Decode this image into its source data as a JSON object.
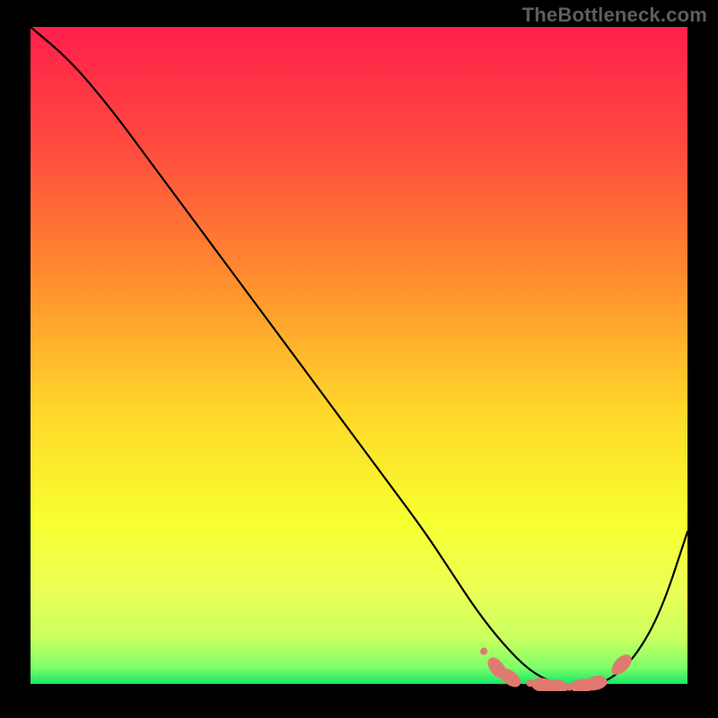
{
  "watermark": "TheBottleneck.com",
  "colors": {
    "background": "#000000",
    "gradient_stops": [
      {
        "offset": 0.0,
        "color": "#ff1f4b"
      },
      {
        "offset": 0.18,
        "color": "#ff4a3f"
      },
      {
        "offset": 0.38,
        "color": "#ff8c2e"
      },
      {
        "offset": 0.58,
        "color": "#ffd62a"
      },
      {
        "offset": 0.75,
        "color": "#f7ff2f"
      },
      {
        "offset": 0.86,
        "color": "#eaff56"
      },
      {
        "offset": 0.93,
        "color": "#c9ff60"
      },
      {
        "offset": 0.975,
        "color": "#7dff69"
      },
      {
        "offset": 1.0,
        "color": "#17e766"
      }
    ],
    "curve": "#000000",
    "beads": "#e07a70"
  },
  "chart_data": {
    "type": "line",
    "title": "",
    "xlabel": "",
    "ylabel": "",
    "xlim": [
      0,
      100
    ],
    "ylim": [
      0,
      100
    ],
    "grid": false,
    "legend": false,
    "series": [
      {
        "name": "bottleneck-curve",
        "x": [
          0,
          6,
          12,
          18,
          24,
          30,
          36,
          42,
          48,
          54,
          60,
          64,
          68,
          72,
          76,
          80,
          84,
          88,
          92,
          96,
          100
        ],
        "y": [
          100,
          95,
          88,
          80,
          72,
          64,
          56,
          48,
          40,
          32,
          24,
          18,
          12,
          7,
          3,
          1,
          0.5,
          1.5,
          5,
          12,
          24
        ]
      }
    ],
    "markers": {
      "name": "optimal-range-beads",
      "points": [
        {
          "x": 69,
          "y": 6.0
        },
        {
          "x": 71,
          "y": 3.5
        },
        {
          "x": 73,
          "y": 2.0
        },
        {
          "x": 76,
          "y": 1.2
        },
        {
          "x": 78,
          "y": 0.9
        },
        {
          "x": 80,
          "y": 0.7
        },
        {
          "x": 82,
          "y": 0.6
        },
        {
          "x": 84,
          "y": 0.8
        },
        {
          "x": 86,
          "y": 1.2
        },
        {
          "x": 89,
          "y": 3.0
        },
        {
          "x": 90,
          "y": 4.0
        }
      ]
    }
  }
}
